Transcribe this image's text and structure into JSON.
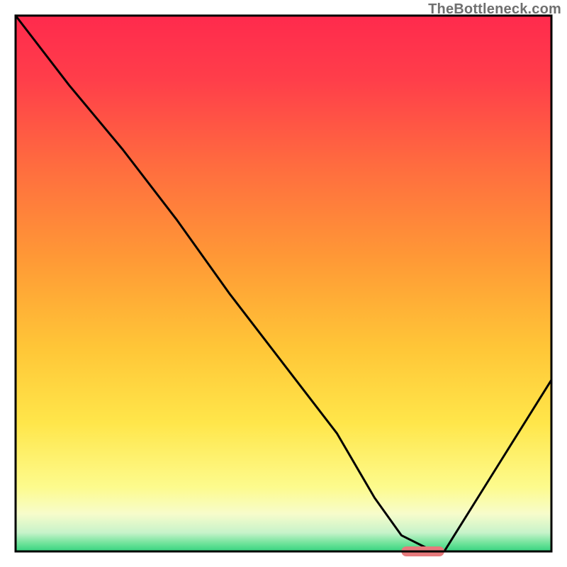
{
  "watermark": "TheBottleneck.com",
  "chart_data": {
    "type": "line",
    "title": "",
    "xlabel": "",
    "ylabel": "",
    "xlim": [
      0,
      100
    ],
    "ylim": [
      0,
      100
    ],
    "series": [
      {
        "name": "bottleneck-curve",
        "x": [
          0,
          10,
          20,
          30,
          40,
          50,
          60,
          67,
          72,
          78,
          80,
          90,
          100
        ],
        "y": [
          100,
          87,
          75,
          62,
          48,
          35,
          22,
          10,
          3,
          0,
          0,
          16,
          32
        ]
      }
    ],
    "marker": {
      "x_start": 72,
      "x_end": 80,
      "y": 0,
      "color": "#e77a7c"
    },
    "gradient_stops": [
      {
        "offset": 0.0,
        "color": "#ff2a4d"
      },
      {
        "offset": 0.12,
        "color": "#ff3e4a"
      },
      {
        "offset": 0.28,
        "color": "#ff6c3f"
      },
      {
        "offset": 0.45,
        "color": "#ff9836"
      },
      {
        "offset": 0.62,
        "color": "#ffc637"
      },
      {
        "offset": 0.76,
        "color": "#ffe64a"
      },
      {
        "offset": 0.88,
        "color": "#fdfb8d"
      },
      {
        "offset": 0.93,
        "color": "#f7fccb"
      },
      {
        "offset": 0.965,
        "color": "#c7f3ca"
      },
      {
        "offset": 0.985,
        "color": "#6fe39a"
      },
      {
        "offset": 1.0,
        "color": "#35d37f"
      }
    ],
    "frame_color": "#000000",
    "curve_color": "#000000"
  }
}
